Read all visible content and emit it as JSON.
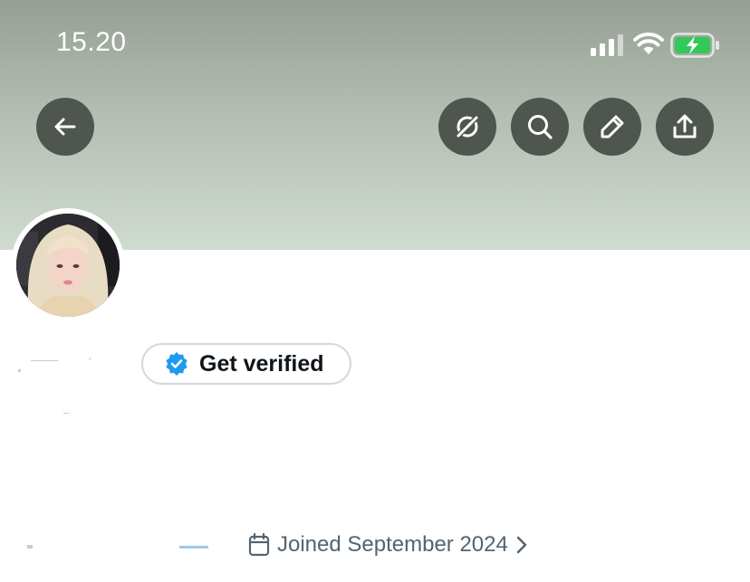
{
  "status_bar": {
    "time": "15.20",
    "icons": [
      "signal-icon",
      "wifi-icon",
      "battery-charging-icon"
    ],
    "battery_color": "#34c759"
  },
  "header": {
    "buttons": [
      {
        "name": "back-button",
        "icon": "arrow-left-icon"
      },
      {
        "name": "grok-button",
        "icon": "grok-icon"
      },
      {
        "name": "search-button",
        "icon": "search-icon"
      },
      {
        "name": "edit-button",
        "icon": "pencil-icon"
      },
      {
        "name": "share-button",
        "icon": "share-icon"
      }
    ],
    "button_color": "#4f564f"
  },
  "profile": {
    "avatar_icon": "avatar",
    "get_verified_label": "Get verified",
    "verified_badge_color": "#1d9bf0",
    "joined_text": "Joined September 2024"
  },
  "colors": {
    "banner_top": "#959f93",
    "banner_bottom": "#d0dbcf",
    "text_secondary": "#536471"
  }
}
